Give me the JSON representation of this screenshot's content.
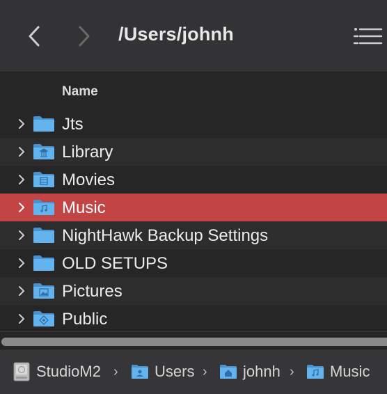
{
  "toolbar": {
    "path_title": "/Users/johnh",
    "back_icon": "chevron-left-icon",
    "forward_icon": "chevron-right-icon",
    "view_options_icon": "list-options-icon"
  },
  "header": {
    "name_column": "Name"
  },
  "rows": [
    {
      "label": "Jts",
      "icon": "folder-icon",
      "selected": false
    },
    {
      "label": "Library",
      "icon": "library-folder-icon",
      "selected": false
    },
    {
      "label": "Movies",
      "icon": "movies-folder-icon",
      "selected": false
    },
    {
      "label": "Music",
      "icon": "music-folder-icon",
      "selected": true
    },
    {
      "label": "NightHawk Backup Settings",
      "icon": "folder-icon",
      "selected": false
    },
    {
      "label": "OLD SETUPS",
      "icon": "folder-icon",
      "selected": false
    },
    {
      "label": "Pictures",
      "icon": "pictures-folder-icon",
      "selected": false
    },
    {
      "label": "Public",
      "icon": "public-folder-icon",
      "selected": false
    }
  ],
  "pathbar": {
    "items": [
      {
        "label": "StudioM2",
        "icon": "hard-drive-icon"
      },
      {
        "label": "Users",
        "icon": "users-folder-icon"
      },
      {
        "label": "johnh",
        "icon": "home-folder-icon"
      },
      {
        "label": "Music",
        "icon": "music-folder-icon"
      }
    ],
    "separator": "›"
  },
  "colors": {
    "selection": "#c24444",
    "folder": "#5aa9e6",
    "toolbar": "#333335"
  }
}
